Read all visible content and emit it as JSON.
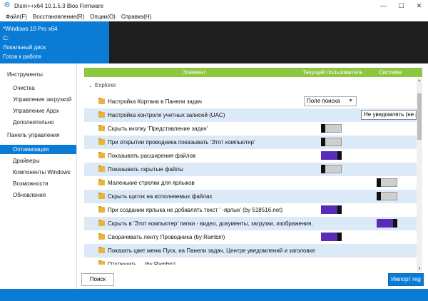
{
  "window": {
    "title": "Dism++x64 10.1.5.3 Bios Firmware",
    "controls": [
      "—",
      "☐",
      "✕"
    ]
  },
  "menu": [
    "Файл(F)",
    "Восстановление(R)",
    "Опции(O)",
    "Справка(H)"
  ],
  "info": {
    "os": "*Windows 10 Pro x64",
    "drive": "C:",
    "disk_type": "Локальный диск",
    "status": "Готов к работе"
  },
  "sidebar": {
    "section1": "Инструменты",
    "tools": [
      "Очистка",
      "Управление загрузкой",
      "Управление Appx",
      "Дополнительно"
    ],
    "section2": "Панель управления",
    "panel": [
      "Оптимизация",
      "Драйверы",
      "Компоненты Windows",
      "Возможности",
      "Обновления"
    ]
  },
  "table": {
    "headers": {
      "element": "Элемент",
      "current_user": "Текущий пользователь",
      "system": "Система"
    },
    "group": "Explorer",
    "rows": [
      "Настройка Кортана в Панели задач",
      "Настройка контроля учетных записей (UAC)",
      "Скрыть кнопку 'Представление задач'",
      "При открытии проводника показывать 'Этот компьютер'",
      "Показывать расширения файлов",
      "Показывать скрытые файлы",
      "Маленькие стрелки для ярлыков",
      "Скрыть щиток на исполняемых файлах",
      "При создании ярлыка не добавлять текст ' -ярлык' (by 518516.net)",
      "Скрыть в 'Этот компьютер' папки - видео, документы, загрузки, изображения.",
      "Сворачивать ленту Проводника  (by Rambin)",
      "Показать цвет меню Пуск, на Панели задач, Центре уведомлений и заголовке",
      "Отключить ... (by Rambin)"
    ],
    "dropdown_value": "Поле поиска",
    "tooltip_value": "Не уведомлять (не р"
  },
  "buttons": {
    "search": "Поиск",
    "import": "Импорт reg"
  },
  "colors": {
    "accent": "#0b7cd6",
    "header": "#8dc63f",
    "toggle_on": "#5a2bb6"
  }
}
